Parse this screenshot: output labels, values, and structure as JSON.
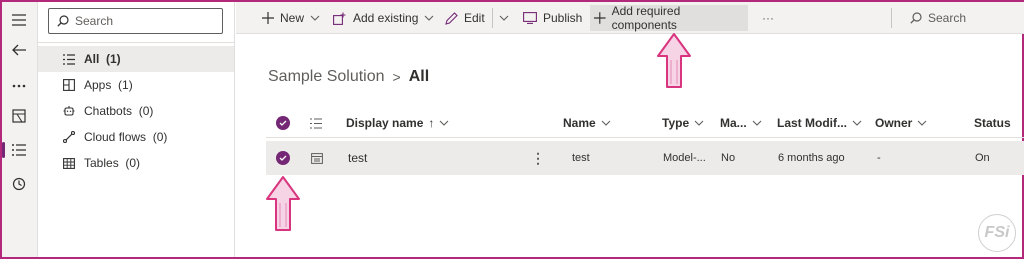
{
  "side_panel": {
    "search_placeholder": "Search",
    "items": [
      {
        "label": "All",
        "count": "(1)"
      },
      {
        "label": "Apps",
        "count": "(1)"
      },
      {
        "label": "Chatbots",
        "count": "(0)"
      },
      {
        "label": "Cloud flows",
        "count": "(0)"
      },
      {
        "label": "Tables",
        "count": "(0)"
      }
    ]
  },
  "toolbar": {
    "new_label": "New",
    "add_existing_label": "Add existing",
    "edit_label": "Edit",
    "publish_label": "Publish",
    "add_required_label": "Add required components",
    "more_label": "···",
    "search_placeholder": "Search"
  },
  "breadcrumb": {
    "parent": "Sample Solution",
    "separator": ">",
    "current": "All"
  },
  "grid": {
    "columns": {
      "display_name": "Display name",
      "name": "Name",
      "type": "Type",
      "managed": "Ma...",
      "last_modified": "Last Modif...",
      "owner": "Owner",
      "status": "Status"
    },
    "rows": [
      {
        "display_name": "test",
        "row_menu": "⋮",
        "name": "test",
        "type": "Model-...",
        "managed": "No",
        "last_modified": "6 months ago",
        "owner": "-",
        "status": "On"
      }
    ]
  },
  "watermark": "FSi",
  "colors": {
    "accent": "#742774",
    "annotation_arrow": "#d8357e",
    "frame": "#b4287c"
  }
}
